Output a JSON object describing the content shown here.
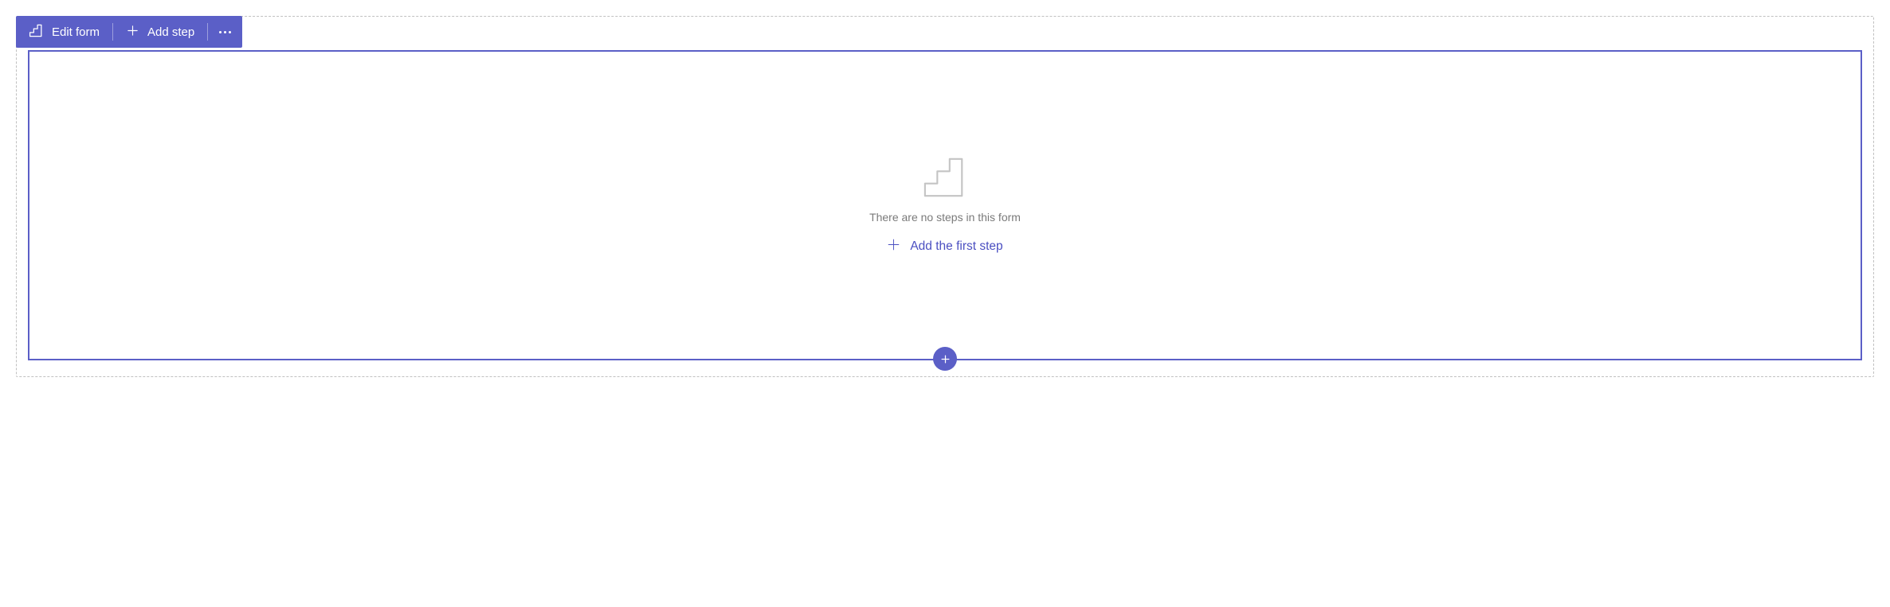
{
  "toolbar": {
    "edit_form_label": "Edit form",
    "add_step_label": "Add step"
  },
  "empty_state": {
    "message": "There are no steps in this form",
    "add_first_label": "Add the first step"
  },
  "icons": {
    "edit_form": "form-icon",
    "add_step": "plus-icon",
    "more": "ellipsis-icon",
    "empty_steps": "steps-icon",
    "add_first": "plus-icon",
    "floating_add": "plus-icon"
  },
  "colors": {
    "primary": "#5b5fc7",
    "muted_text": "#7a7a7a",
    "dashed_border": "#c0c0c0"
  }
}
